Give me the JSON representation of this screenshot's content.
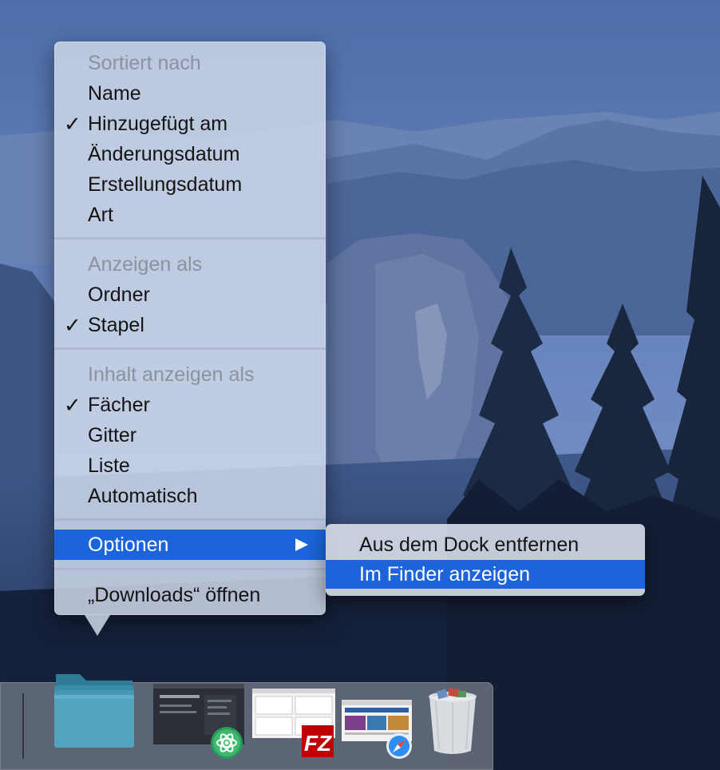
{
  "context_menu": {
    "sort_header": "Sortiert nach",
    "sort_items": [
      {
        "label": "Name",
        "checked": false
      },
      {
        "label": "Hinzugefügt am",
        "checked": true
      },
      {
        "label": "Änderungsdatum",
        "checked": false
      },
      {
        "label": "Erstellungsdatum",
        "checked": false
      },
      {
        "label": "Art",
        "checked": false
      }
    ],
    "display_header": "Anzeigen als",
    "display_items": [
      {
        "label": "Ordner",
        "checked": false
      },
      {
        "label": "Stapel",
        "checked": true
      }
    ],
    "content_header": "Inhalt anzeigen als",
    "content_items": [
      {
        "label": "Fächer",
        "checked": true
      },
      {
        "label": "Gitter",
        "checked": false
      },
      {
        "label": "Liste",
        "checked": false
      },
      {
        "label": "Automatisch",
        "checked": false
      }
    ],
    "options_label": "Optionen",
    "open_label": "„Downloads“ öffnen",
    "checkmark": "✓"
  },
  "submenu": {
    "items": [
      {
        "label": "Aus dem Dock entfernen",
        "selected": false
      },
      {
        "label": "Im Finder anzeigen",
        "selected": true
      }
    ]
  },
  "dock": {
    "items": [
      {
        "name": "downloads-folder",
        "icon": "folder-icon"
      },
      {
        "name": "atom",
        "icon": "atom-icon"
      },
      {
        "name": "filezilla",
        "icon": "filezilla-icon",
        "badge": "FZ"
      },
      {
        "name": "safari",
        "icon": "safari-icon"
      },
      {
        "name": "trash",
        "icon": "trash-icon"
      }
    ]
  },
  "colors": {
    "selection": "#1b64d9",
    "header_text": "#8b92a2",
    "sky": "#5c79b4"
  }
}
